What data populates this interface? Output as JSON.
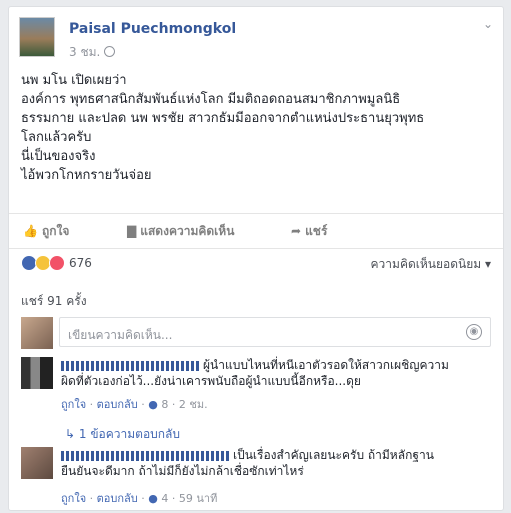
{
  "post": {
    "author": "Paisal Puechmongkol",
    "time": "3 ชม.",
    "lines": [
      "นพ มโน เปิดเผยว่า",
      "องค์การ พุทธศาสนิกสัมพันธ์แห่งโลก มีมติถอดถอนสมาชิกภาพมูลนิธิ",
      "ธรรมกาย และปลด นพ พรชัย สาวกธัมมีออกจากตำแหน่งประธานยุวพุทธ",
      "โลกแล้วครับ",
      "นี่เป็นของจริง",
      "ไอ้พวกโกหกรายวันจ่อย"
    ]
  },
  "actions": {
    "like": "ถูกใจ",
    "comment": "แสดงความคิดเห็น",
    "share": "แชร์"
  },
  "reactions": {
    "count": "676",
    "sort_label": "ความคิดเห็นยอดนิยม"
  },
  "shares_label": "แชร์ 91 ครั้ง",
  "comment_input": {
    "placeholder": "เขียนความคิดเห็น..."
  },
  "comments": [
    {
      "line1": "ผู้นำแบบไหนที่หนีเอาตัวรอดให้สาวกเผชิญความ",
      "line2": "ผิดที่ตัวเองก่อไว้...ยังน่าเคารพนับถือผู้นำแบบนี้อีกหรือ...ดุย",
      "like": "ถูกใจ",
      "reply": "ตอบกลับ",
      "likes": "8",
      "time": "2 ชม."
    },
    {
      "line1": "เป็นเรื่องสำคัญเลยนะครับ ถ้ามีหลักฐาน",
      "line2": "ยืนยันจะดีมาก ถ้าไม่มีก็ยังไม่กล้าเชื่อซักเท่าไหร่",
      "like": "ถูกใจ",
      "reply": "ตอบกลับ",
      "likes": "4",
      "time": "59 นาที"
    }
  ],
  "replies_link": "1 ข้อความตอบกลับ",
  "colors": {
    "link": "#365899",
    "muted": "#90949c",
    "accent": "#4267b2"
  }
}
